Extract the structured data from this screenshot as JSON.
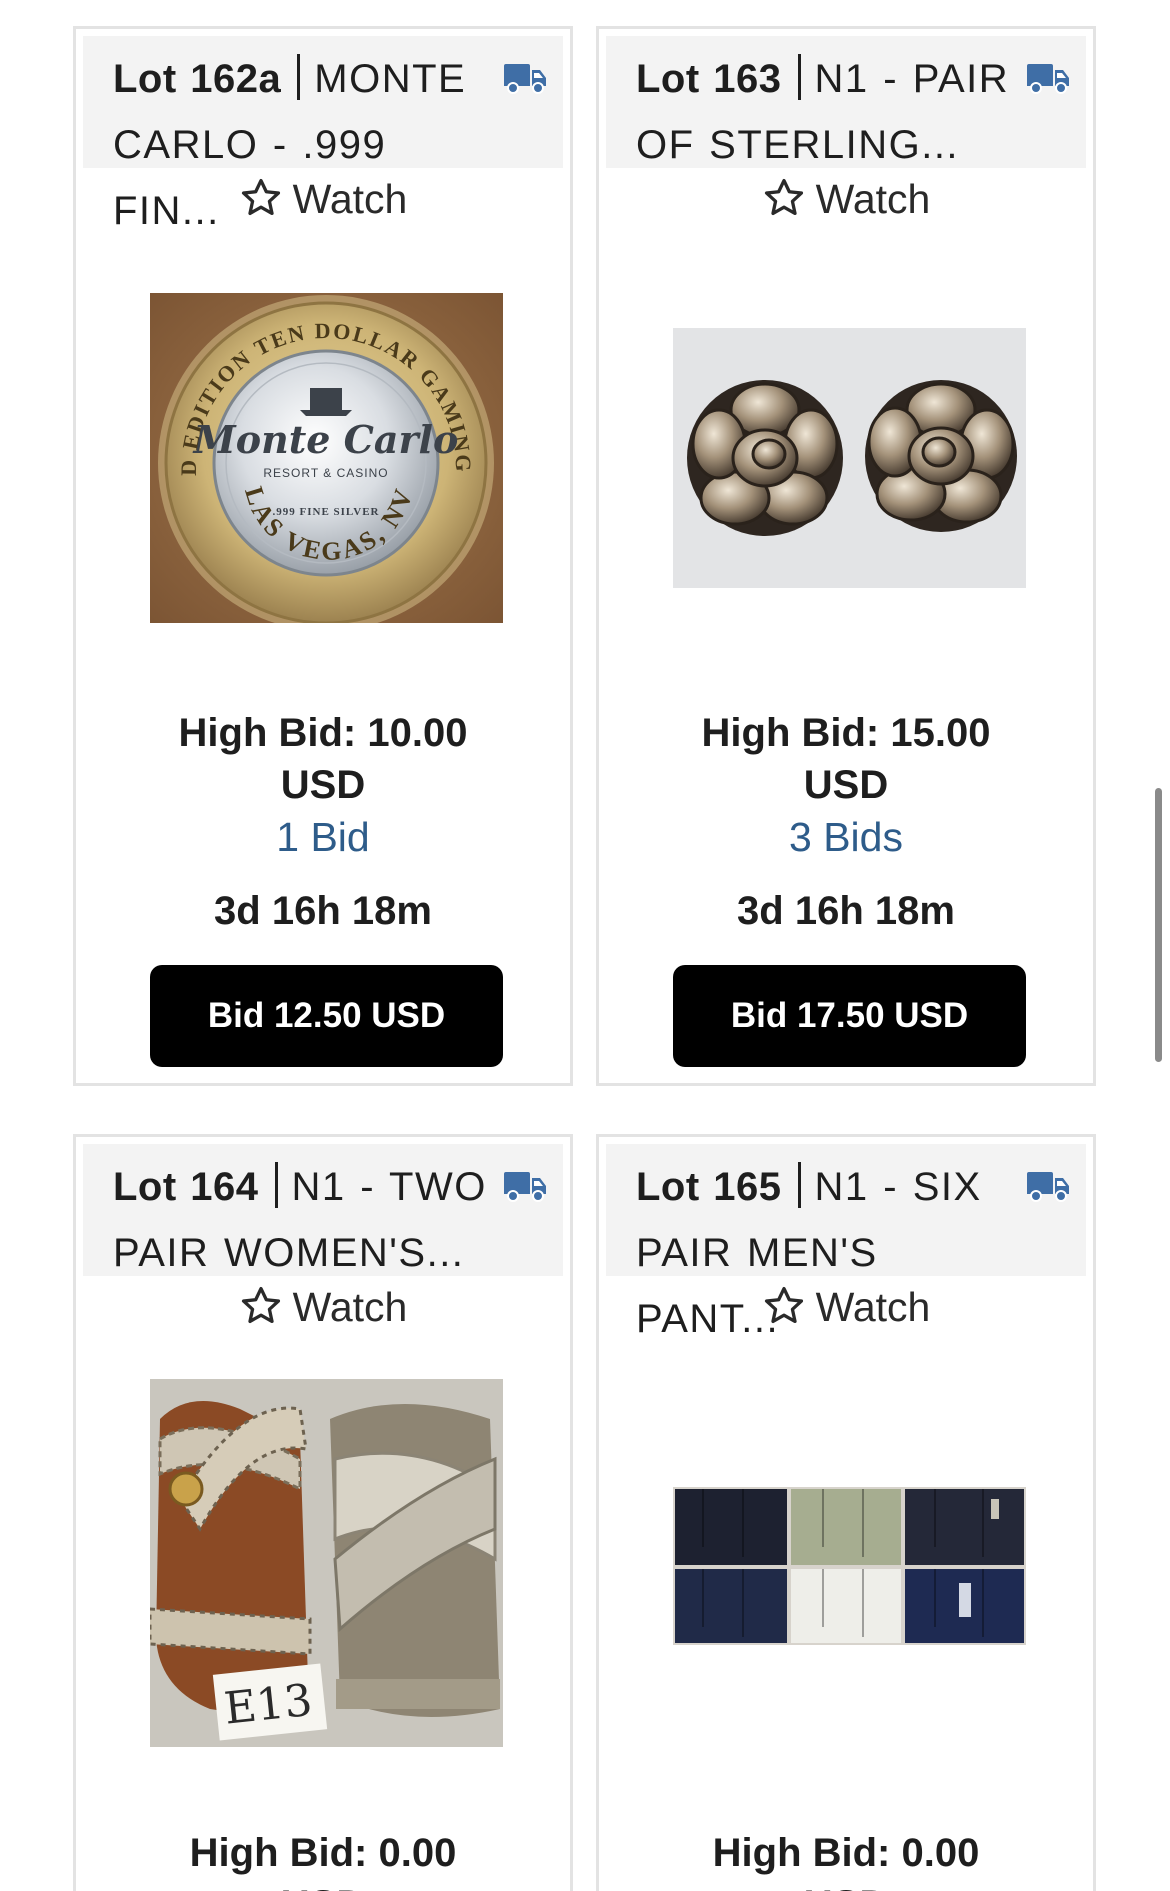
{
  "lots": [
    {
      "lot_number": "Lot 162a",
      "title": "MONTE CARLO - .999 FIN...",
      "shipping_icon": "truck-icon",
      "watch_label": "Watch",
      "image_alt": "Monte Carlo Resort & Casino ten dollar gaming token",
      "image_text": {
        "ring_top": "LIMITED EDITION TEN DOLLAR GAMING TOKEN",
        "brand": "Monte Carlo",
        "sub": "RESORT & CASINO",
        "fine": ".999 FINE SILVER",
        "city": "LAS VEGAS, NV"
      },
      "high_bid_line1": "High Bid: 10.00",
      "high_bid_line2": "USD",
      "bids": "1 Bid",
      "time_left": "3d 16h 18m",
      "bid_button": "Bid 12.50 USD"
    },
    {
      "lot_number": "Lot 163",
      "title": "N1 - PAIR OF STERLING...",
      "shipping_icon": "truck-icon",
      "watch_label": "Watch",
      "image_alt": "Pair of sterling rose earrings",
      "high_bid_line1": "High Bid: 15.00",
      "high_bid_line2": "USD",
      "bids": "3 Bids",
      "time_left": "3d 16h 18m",
      "bid_button": "Bid 17.50 USD"
    },
    {
      "lot_number": "Lot 164",
      "title": "N1 - TWO PAIR WOMEN'S...",
      "shipping_icon": "truck-icon",
      "watch_label": "Watch",
      "image_alt": "Two pairs of women's sandals",
      "image_text": {
        "tag": "E13"
      },
      "high_bid_line1": "High Bid: 0.00",
      "high_bid_line2": "USD"
    },
    {
      "lot_number": "Lot 165",
      "title": "N1 - SIX PAIR MEN'S PANT...",
      "shipping_icon": "truck-icon",
      "watch_label": "Watch",
      "image_alt": "Six pairs of men's pants",
      "high_bid_line1": "High Bid: 0.00",
      "high_bid_line2": "USD"
    }
  ],
  "colors": {
    "truck_icon": "#3f6ea6",
    "bids_link": "#2e5c8a",
    "bid_button_bg": "#000000",
    "card_header_bg": "#f3f3f3"
  }
}
